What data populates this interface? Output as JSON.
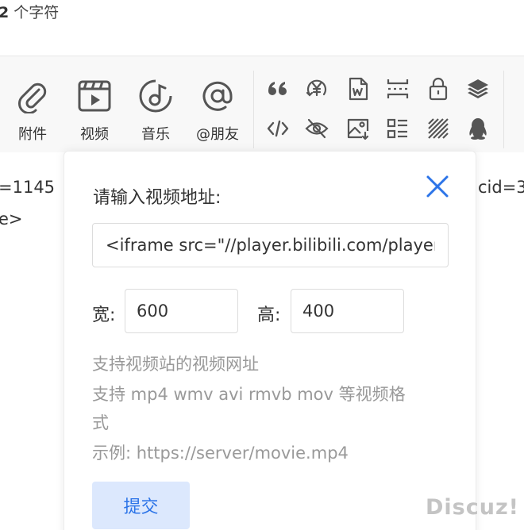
{
  "editor": {
    "char_count": "2",
    "char_count_suffix": "个字符"
  },
  "toolbar": {
    "big_buttons": [
      {
        "label": "附件",
        "icon": "paperclip-icon"
      },
      {
        "label": "视频",
        "icon": "video-icon"
      },
      {
        "label": "音乐",
        "icon": "music-icon"
      },
      {
        "label": "@朋友",
        "icon": "at-icon"
      }
    ],
    "small_buttons": [
      "quote-icon",
      "currency-icon",
      "word-doc-icon",
      "page-break-icon",
      "lock-icon",
      "layers-icon",
      "code-icon",
      "hide-icon",
      "image-icon",
      "list-icon",
      "hatch-icon",
      "qq-icon"
    ]
  },
  "background": {
    "line1_left": "=1145",
    "line1_right": "cid=3",
    "line2_left": "e>"
  },
  "dialog": {
    "title": "请输入视频地址:",
    "url_value": "<iframe src=\"//player.bilibili.com/player.html",
    "width_label": "宽:",
    "width_value": "600",
    "height_label": "高:",
    "height_value": "400",
    "hint1": "支持视频站的视频网址",
    "hint2": "支持 mp4 wmv avi rmvb mov 等视频格",
    "hint3": "式",
    "hint4": "示例: https://server/movie.mp4",
    "submit_label": "提交"
  },
  "watermark": "Discuz!",
  "colors": {
    "accent": "#2c74e8",
    "submit_bg": "#dce8fd",
    "icon": "#555555"
  }
}
